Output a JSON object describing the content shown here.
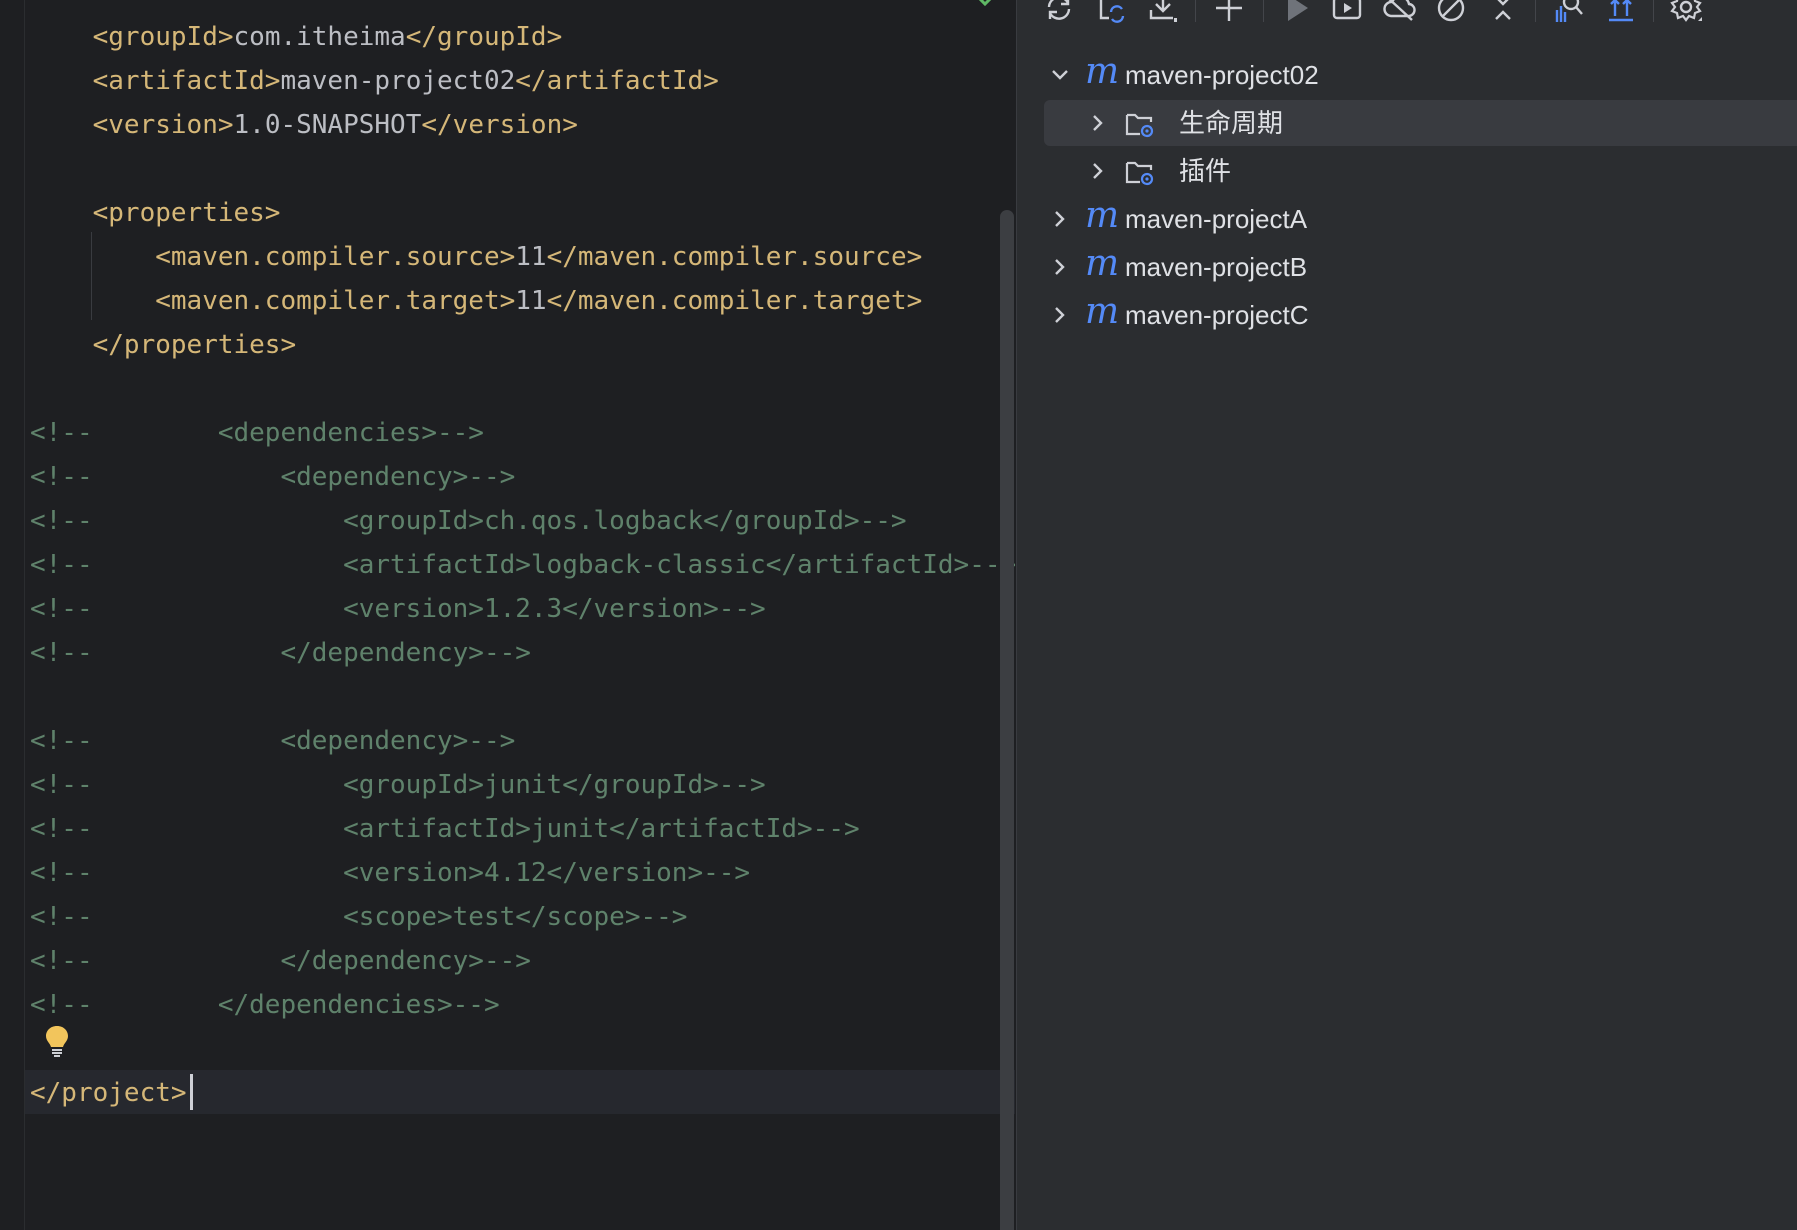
{
  "editor": {
    "lines": [
      {
        "segments": [
          {
            "t": "    ",
            "c": "txt"
          },
          {
            "t": "<groupId>",
            "c": "tag"
          },
          {
            "t": "com.itheima",
            "c": "txt"
          },
          {
            "t": "</groupId>",
            "c": "tag"
          }
        ]
      },
      {
        "segments": [
          {
            "t": "    ",
            "c": "txt"
          },
          {
            "t": "<artifactId>",
            "c": "tag"
          },
          {
            "t": "maven-project02",
            "c": "txt"
          },
          {
            "t": "</artifactId>",
            "c": "tag"
          }
        ]
      },
      {
        "segments": [
          {
            "t": "    ",
            "c": "txt"
          },
          {
            "t": "<version>",
            "c": "tag"
          },
          {
            "t": "1.0-SNAPSHOT",
            "c": "txt"
          },
          {
            "t": "</version>",
            "c": "tag"
          }
        ]
      },
      {
        "segments": []
      },
      {
        "segments": [
          {
            "t": "    ",
            "c": "txt"
          },
          {
            "t": "<properties>",
            "c": "tag"
          }
        ]
      },
      {
        "segments": [
          {
            "t": "        ",
            "c": "txt"
          },
          {
            "t": "<maven.compiler.source>",
            "c": "tag"
          },
          {
            "t": "11",
            "c": "txt"
          },
          {
            "t": "</maven.compiler.source>",
            "c": "tag"
          }
        ]
      },
      {
        "segments": [
          {
            "t": "        ",
            "c": "txt"
          },
          {
            "t": "<maven.compiler.target>",
            "c": "tag"
          },
          {
            "t": "11",
            "c": "txt"
          },
          {
            "t": "</maven.compiler.target>",
            "c": "tag"
          }
        ]
      },
      {
        "segments": [
          {
            "t": "    ",
            "c": "txt"
          },
          {
            "t": "</properties>",
            "c": "tag"
          }
        ]
      },
      {
        "segments": []
      },
      {
        "segments": [
          {
            "t": "<!--        <dependencies>-->",
            "c": "cmt"
          }
        ]
      },
      {
        "segments": [
          {
            "t": "<!--            <dependency>-->",
            "c": "cmt"
          }
        ]
      },
      {
        "segments": [
          {
            "t": "<!--                <groupId>ch.qos.logback</groupId>-->",
            "c": "cmt"
          }
        ]
      },
      {
        "segments": [
          {
            "t": "<!--                <artifactId>logback-classic</artifactId>-->",
            "c": "cmt"
          }
        ]
      },
      {
        "segments": [
          {
            "t": "<!--                <version>1.2.3</version>-->",
            "c": "cmt"
          }
        ]
      },
      {
        "segments": [
          {
            "t": "<!--            </dependency>-->",
            "c": "cmt"
          }
        ]
      },
      {
        "segments": []
      },
      {
        "segments": [
          {
            "t": "<!--            <dependency>-->",
            "c": "cmt"
          }
        ]
      },
      {
        "segments": [
          {
            "t": "<!--                <groupId>junit</groupId>-->",
            "c": "cmt"
          }
        ]
      },
      {
        "segments": [
          {
            "t": "<!--                <artifactId>junit</artifactId>-->",
            "c": "cmt"
          }
        ]
      },
      {
        "segments": [
          {
            "t": "<!--                <version>4.12</version>-->",
            "c": "cmt"
          }
        ]
      },
      {
        "segments": [
          {
            "t": "<!--                <scope>test</scope>-->",
            "c": "cmt"
          }
        ]
      },
      {
        "segments": [
          {
            "t": "<!--            </dependency>-->",
            "c": "cmt"
          }
        ]
      },
      {
        "segments": [
          {
            "t": "<!--        </dependencies>-->",
            "c": "cmt"
          }
        ]
      },
      {
        "segments": []
      },
      {
        "segments": [
          {
            "t": "</project>",
            "c": "tag"
          }
        ]
      }
    ]
  },
  "maven_panel": {
    "toolbar": {
      "icons": [
        "reload-icon",
        "reimport-icon",
        "download-icon",
        "add-icon",
        "run-icon",
        "execute-goal-icon",
        "offline-icon",
        "skip-tests-icon",
        "collapse-icon",
        "analyze-dependencies-icon",
        "show-dependencies-icon",
        "settings-icon"
      ]
    },
    "tree": [
      {
        "label": "maven-project02",
        "icon": "maven-m-icon",
        "expanded": true,
        "level": 0
      },
      {
        "label": "生命周期",
        "icon": "lifecycle-folder-icon",
        "expanded": false,
        "level": 1,
        "selected": true
      },
      {
        "label": "插件",
        "icon": "plugins-folder-icon",
        "expanded": false,
        "level": 1
      },
      {
        "label": "maven-projectA",
        "icon": "maven-m-icon",
        "expanded": false,
        "level": 0
      },
      {
        "label": "maven-projectB",
        "icon": "maven-m-icon",
        "expanded": false,
        "level": 0
      },
      {
        "label": "maven-projectC",
        "icon": "maven-m-icon",
        "expanded": false,
        "level": 0
      }
    ]
  },
  "colors": {
    "editor_bg": "#1e1f22",
    "panel_bg": "#2b2d30",
    "xml_tag": "#d5b778",
    "xml_text": "#bcbec4",
    "comment": "#5f826b",
    "maven_blue": "#548af7"
  }
}
